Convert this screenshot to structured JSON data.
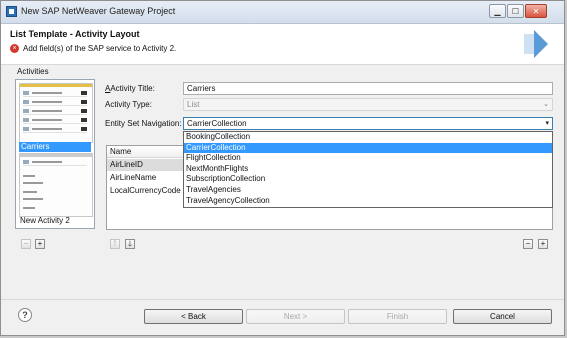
{
  "window": {
    "title": "New SAP NetWeaver Gateway Project"
  },
  "header": {
    "title": "List Template - Activity Layout",
    "message": "Add field(s) of the SAP service to Activity 2."
  },
  "activities": {
    "heading": "Activities",
    "selected_label": "Carriers",
    "name": "New Activity 2",
    "remove_label": "−",
    "add_label": "+"
  },
  "form": {
    "activity_title_label": "Activity Title:",
    "activity_title_value": "Carriers",
    "activity_type_label": "Activity Type:",
    "activity_type_value": "List",
    "entity_set_label": "Entity Set Navigation:",
    "entity_set_value": "CarrierCollection"
  },
  "entity_set_options": [
    "BookingCollection",
    "CarrierCollection",
    "FlightCollection",
    "NextMonthFlights",
    "SubscriptionCollection",
    "TravelAgencies",
    "TravelAgencyCollection"
  ],
  "entity_set_selected_index": 1,
  "grid": {
    "column_header": "Name",
    "rows": [
      "AirLineID",
      "AirLineName",
      "LocalCurrencyCode"
    ]
  },
  "grid_controls": {
    "up_label": "🡑",
    "down_label": "🡓",
    "remove_label": "−",
    "add_label": "+"
  },
  "footer": {
    "help_label": "?",
    "back_label": "< Back",
    "next_label": "Next >",
    "finish_label": "Finish",
    "cancel_label": "Cancel"
  },
  "colors": {
    "selection": "#3399ff",
    "error": "#d4382c",
    "banner_arrow": "#5b9bd5"
  }
}
